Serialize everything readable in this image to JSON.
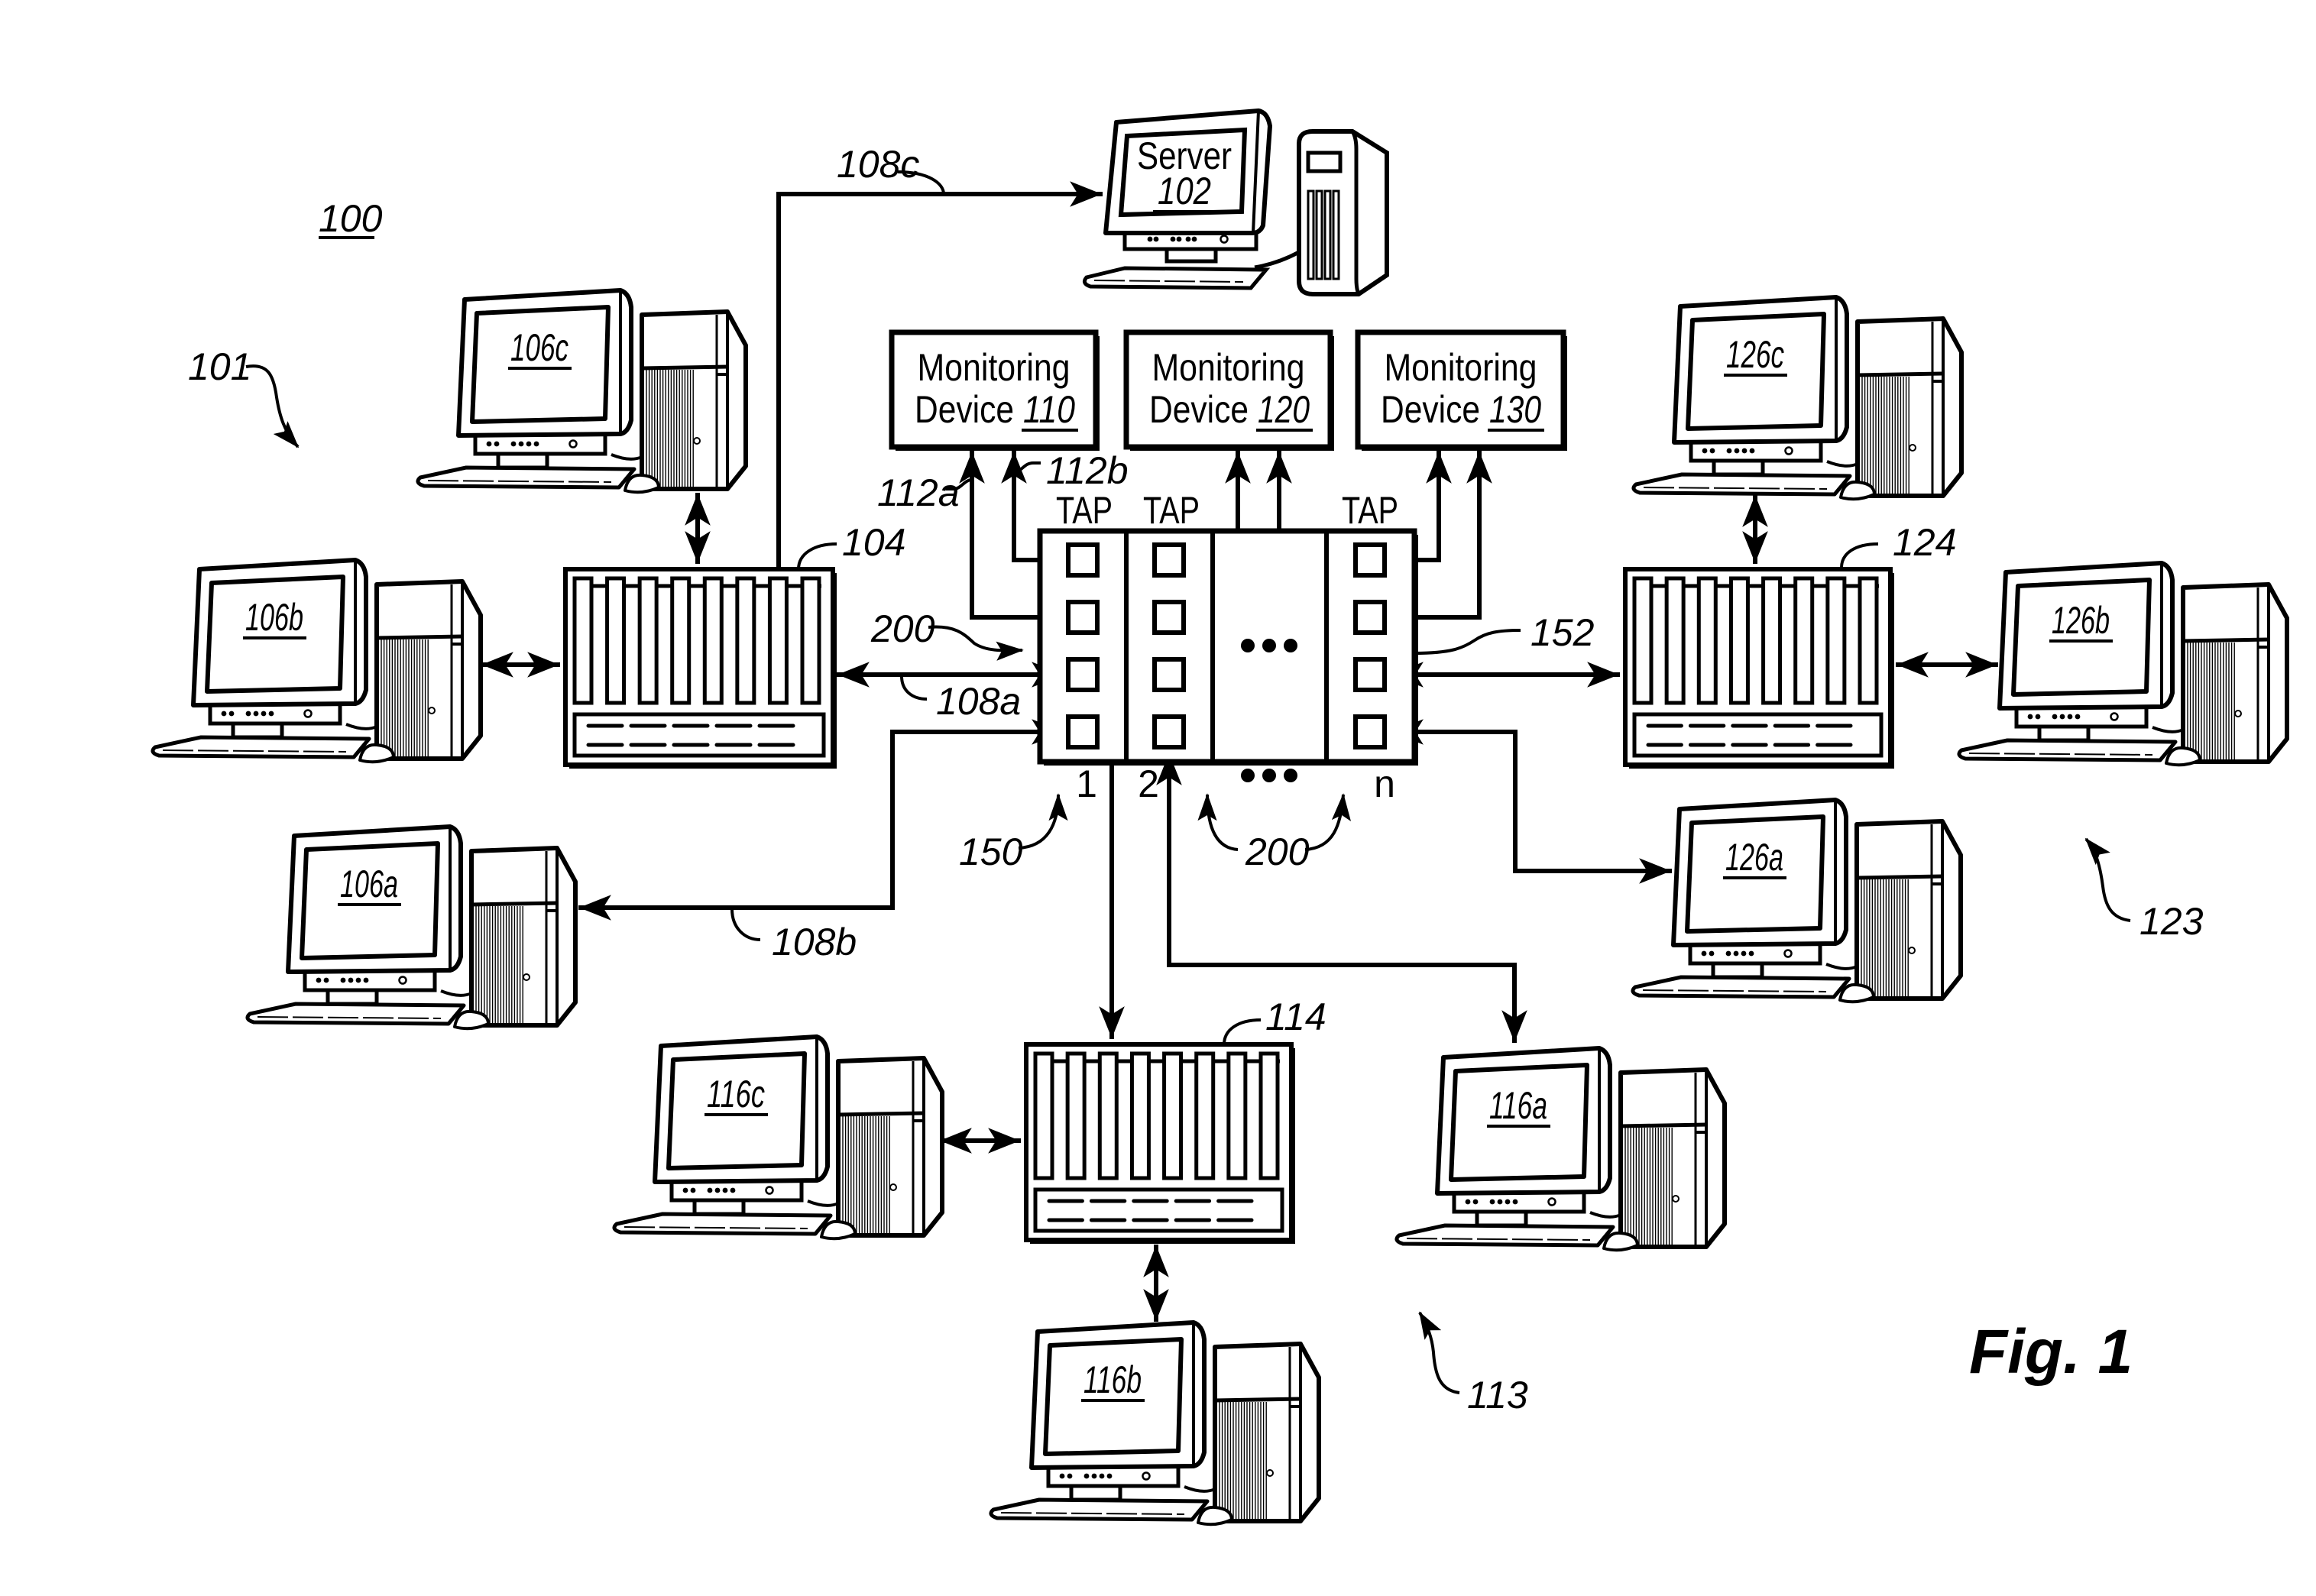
{
  "figure": {
    "title": "Fig. 1",
    "system_ref": "100",
    "colors": {
      "ink": "#000000",
      "paper": "#ffffff"
    }
  },
  "server": {
    "label": "Server",
    "ref": "102"
  },
  "monitoring_devices": [
    {
      "label_line1": "Monitoring",
      "label_line2": "Device",
      "ref": "110"
    },
    {
      "label_line1": "Monitoring",
      "label_line2": "Device",
      "ref": "120"
    },
    {
      "label_line1": "Monitoring",
      "label_line2": "Device",
      "ref": "130"
    }
  ],
  "tap_array": {
    "ref_left": "150",
    "ref_right": "152",
    "ref_module": "200",
    "columns": [
      {
        "header": "TAP",
        "index": "1"
      },
      {
        "header": "TAP",
        "index": "2"
      },
      {
        "header": "",
        "index": "•••"
      },
      {
        "header": "TAP",
        "index": "n"
      }
    ],
    "ellipsis": "•••"
  },
  "networks": [
    {
      "ref": "101",
      "switch_ref": "104",
      "computers": [
        "106a",
        "106b",
        "106c"
      ]
    },
    {
      "ref": "113",
      "switch_ref": "114",
      "computers": [
        "116a",
        "116b",
        "116c"
      ]
    },
    {
      "ref": "123",
      "switch_ref": "124",
      "computers": [
        "126a",
        "126b",
        "126c"
      ]
    }
  ],
  "links": {
    "l108a": "108a",
    "l108b": "108b",
    "l108c": "108c",
    "l112a": "112a",
    "l112b": "112b"
  }
}
